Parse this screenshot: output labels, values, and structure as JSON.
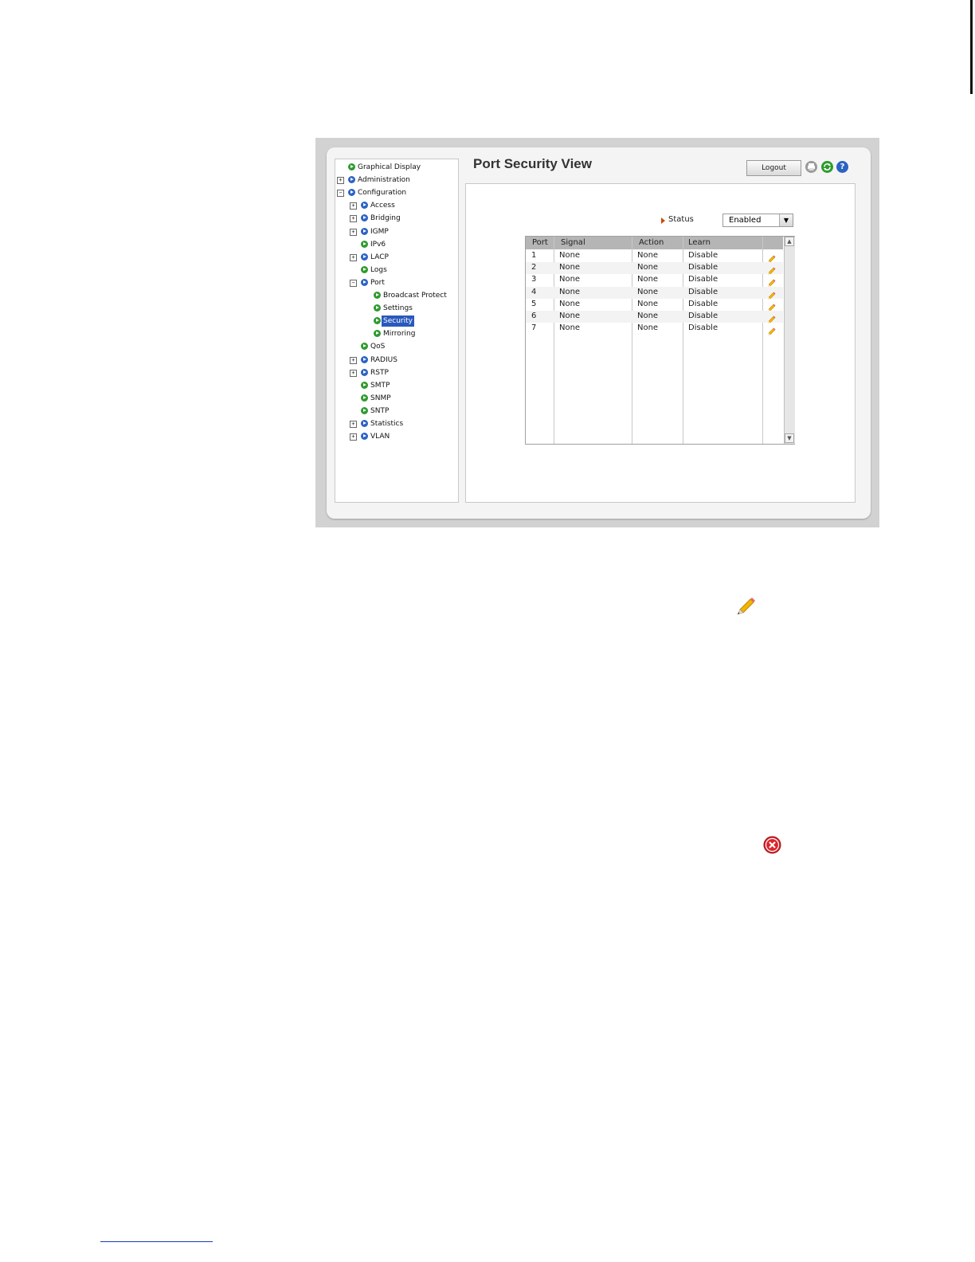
{
  "page_title": "Port Security View",
  "header": {
    "logout_label": "Logout",
    "icons": [
      "print-icon",
      "refresh-icon",
      "help-icon"
    ]
  },
  "tree": [
    {
      "label": "Graphical Display",
      "level": 0,
      "expander": "",
      "bullet": "green"
    },
    {
      "label": "Administration",
      "level": 0,
      "expander": "+",
      "bullet": "blue"
    },
    {
      "label": "Configuration",
      "level": 0,
      "expander": "−",
      "bullet": "blue"
    },
    {
      "label": "Access",
      "level": 1,
      "expander": "+",
      "bullet": "blue"
    },
    {
      "label": "Bridging",
      "level": 1,
      "expander": "+",
      "bullet": "blue"
    },
    {
      "label": "IGMP",
      "level": 1,
      "expander": "+",
      "bullet": "blue"
    },
    {
      "label": "IPv6",
      "level": 1,
      "expander": "",
      "bullet": "green"
    },
    {
      "label": "LACP",
      "level": 1,
      "expander": "+",
      "bullet": "blue"
    },
    {
      "label": "Logs",
      "level": 1,
      "expander": "",
      "bullet": "green"
    },
    {
      "label": "Port",
      "level": 1,
      "expander": "−",
      "bullet": "blue"
    },
    {
      "label": "Broadcast Protect",
      "level": 2,
      "expander": "",
      "bullet": "green"
    },
    {
      "label": "Settings",
      "level": 2,
      "expander": "",
      "bullet": "green"
    },
    {
      "label": "Security",
      "level": 2,
      "expander": "",
      "bullet": "green",
      "selected": true
    },
    {
      "label": "Mirroring",
      "level": 2,
      "expander": "",
      "bullet": "green"
    },
    {
      "label": "QoS",
      "level": 1,
      "expander": "",
      "bullet": "green"
    },
    {
      "label": "RADIUS",
      "level": 1,
      "expander": "+",
      "bullet": "blue"
    },
    {
      "label": "RSTP",
      "level": 1,
      "expander": "+",
      "bullet": "blue"
    },
    {
      "label": "SMTP",
      "level": 1,
      "expander": "",
      "bullet": "green"
    },
    {
      "label": "SNMP",
      "level": 1,
      "expander": "",
      "bullet": "green"
    },
    {
      "label": "SNTP",
      "level": 1,
      "expander": "",
      "bullet": "green"
    },
    {
      "label": "Statistics",
      "level": 1,
      "expander": "+",
      "bullet": "blue"
    },
    {
      "label": "VLAN",
      "level": 1,
      "expander": "+",
      "bullet": "blue"
    }
  ],
  "status": {
    "label": "Status",
    "value": "Enabled"
  },
  "table": {
    "columns": [
      "Port",
      "Signal",
      "Action",
      "Learn",
      ""
    ],
    "rows": [
      [
        "1",
        "None",
        "None",
        "Disable"
      ],
      [
        "2",
        "None",
        "None",
        "Disable"
      ],
      [
        "3",
        "None",
        "None",
        "Disable"
      ],
      [
        "4",
        "None",
        "None",
        "Disable"
      ],
      [
        "5",
        "None",
        "None",
        "Disable"
      ],
      [
        "6",
        "None",
        "None",
        "Disable"
      ],
      [
        "7",
        "None",
        "None",
        "Disable"
      ]
    ]
  },
  "standalone_icons": [
    "edit-pencil-icon",
    "delete-icon"
  ],
  "colors": {
    "selected": "#2a59bd",
    "green_bullet": "#2e9a2e",
    "blue_bullet": "#2b63c2",
    "header_gray": "#b5b5b5"
  }
}
